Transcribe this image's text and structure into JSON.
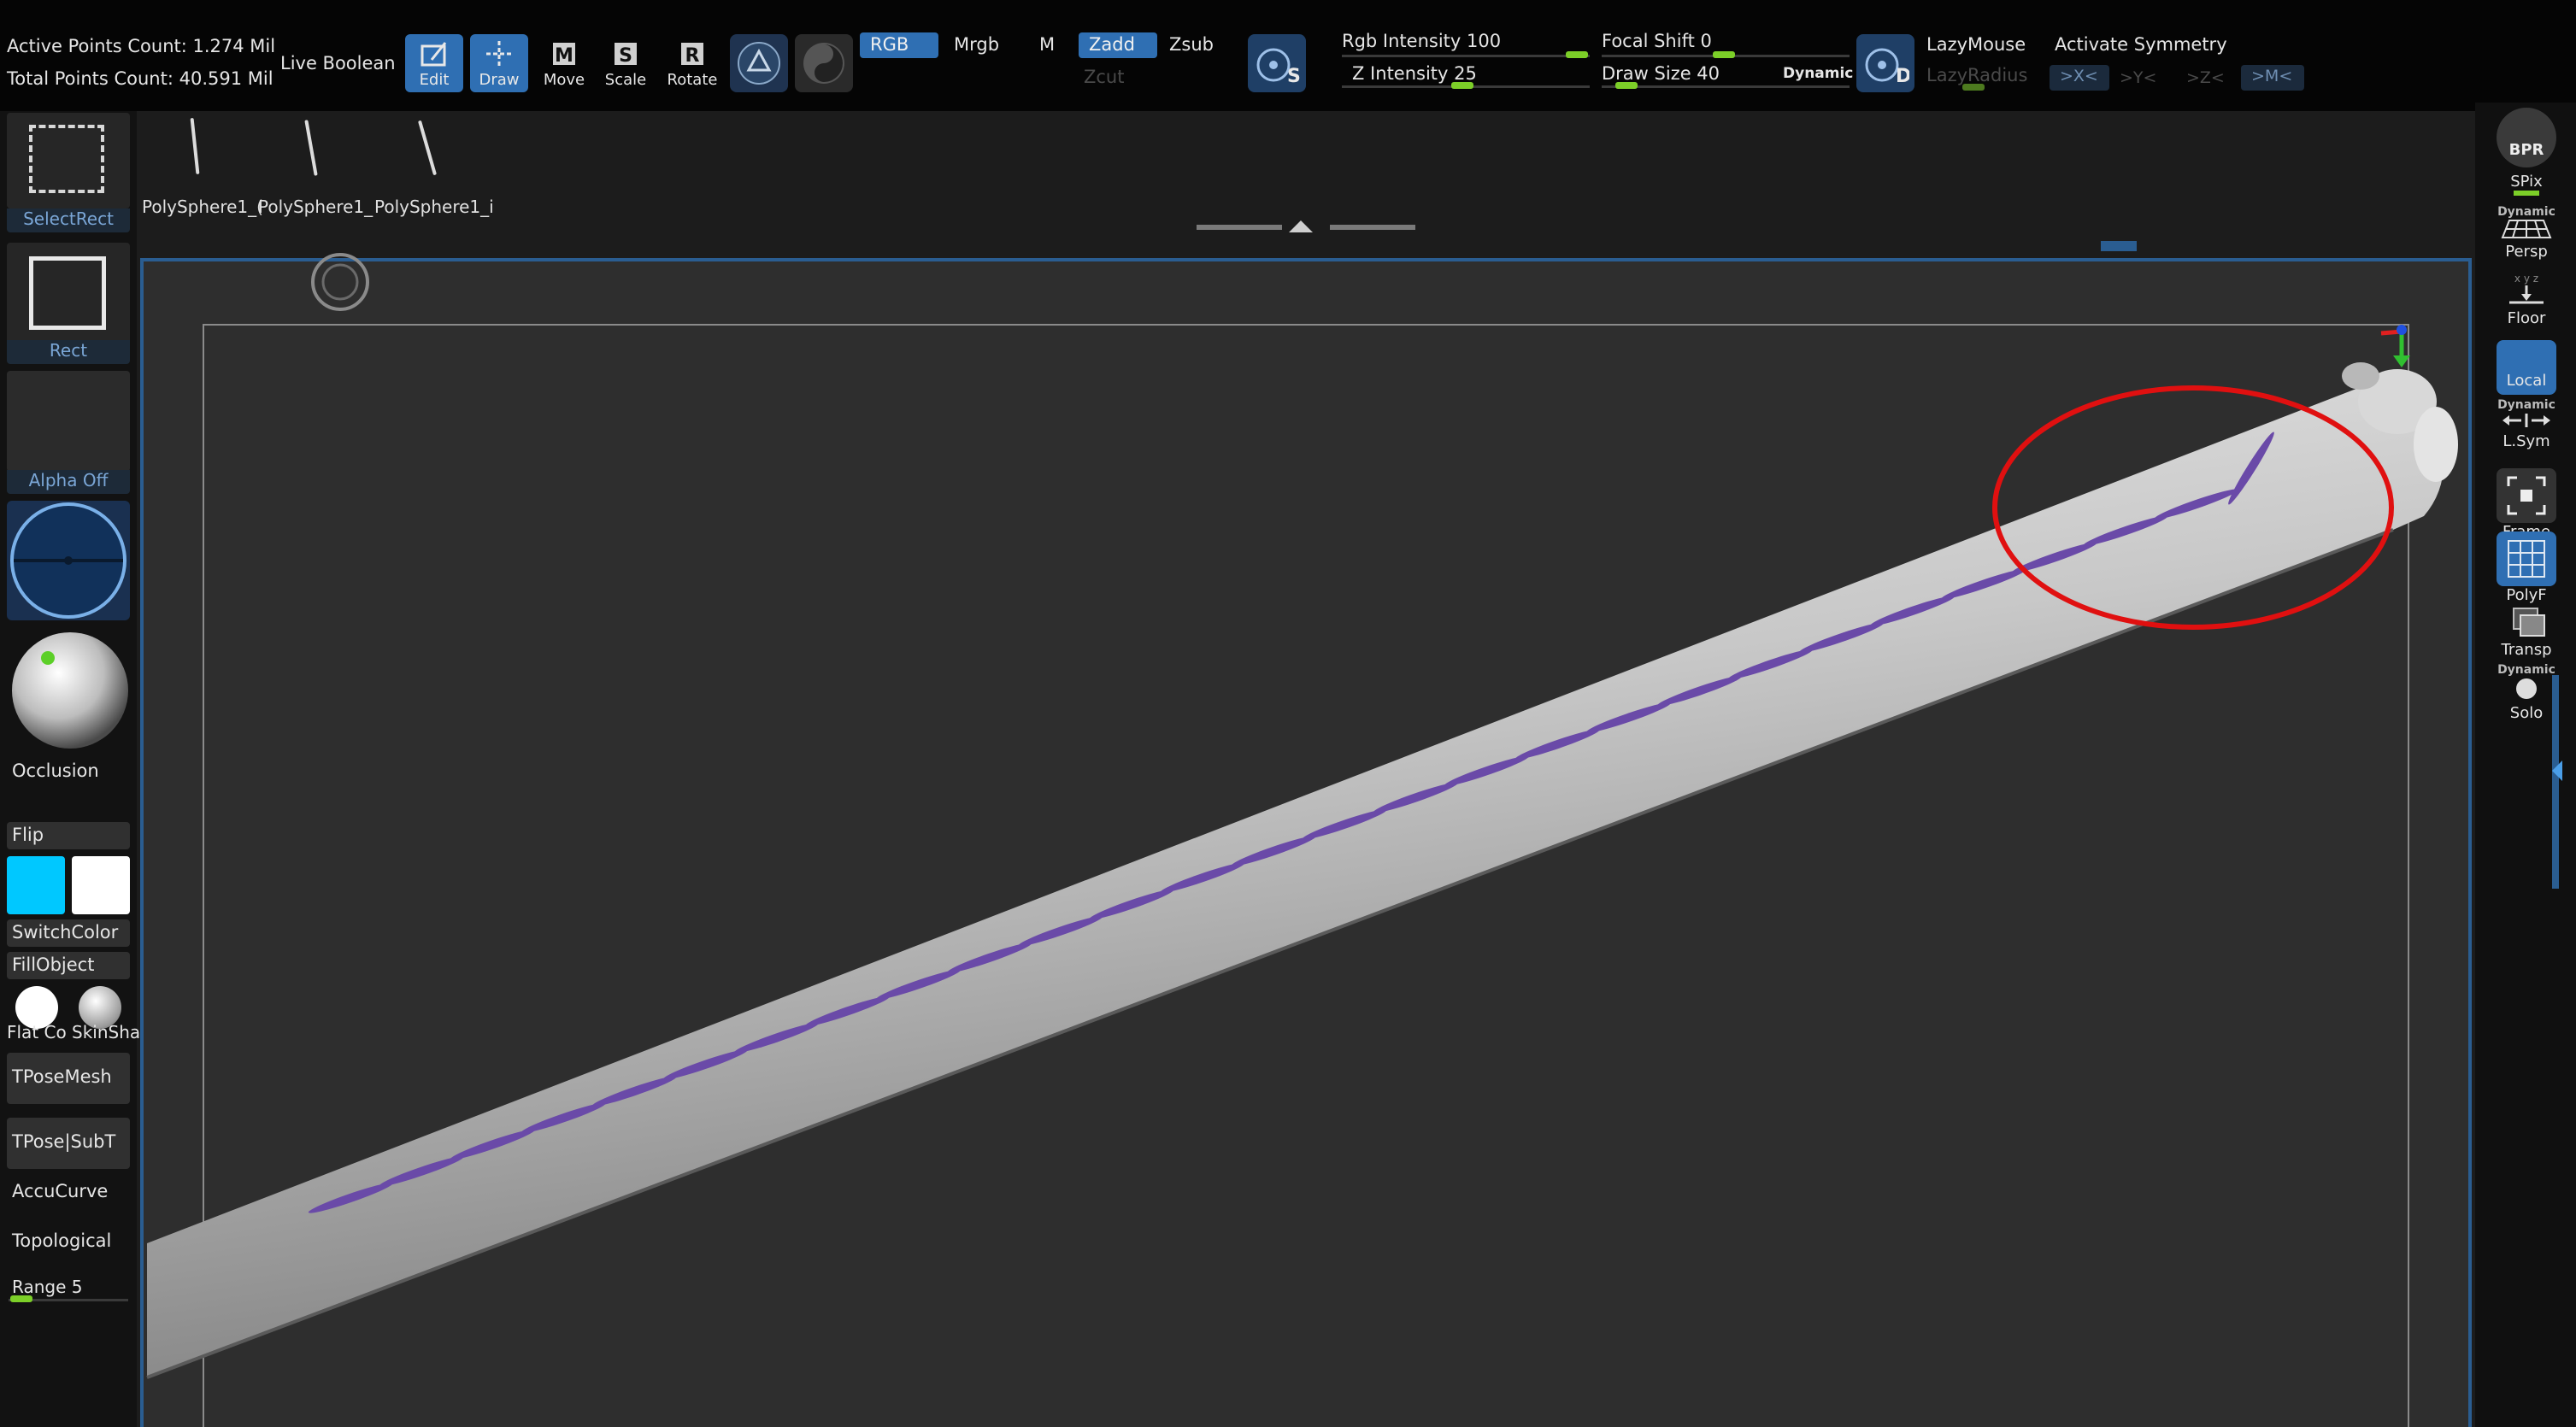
{
  "stats": {
    "active_points": "Active Points Count: 1.274 Mil",
    "total_points": "Total Points Count: 40.591 Mil"
  },
  "toolbar": {
    "live_boolean": "Live Boolean",
    "edit": "Edit",
    "draw": "Draw",
    "move": "Move",
    "scale": "Scale",
    "rotate": "Rotate",
    "rgb": "RGB",
    "mrgb": "Mrgb",
    "m": "M",
    "zadd": "Zadd",
    "zsub": "Zsub",
    "zcut": "Zcut",
    "rgb_intensity": "Rgb Intensity 100",
    "z_intensity": "Z Intensity 25",
    "focal_shift": "Focal Shift 0",
    "draw_size": "Draw Size 40",
    "dynamic": "Dynamic",
    "lazymouse": "LazyMouse",
    "lazyradius": "LazyRadius",
    "activate_symmetry": "Activate Symmetry",
    "sym_x": ">X<",
    "sym_y": ">Y<",
    "sym_z": ">Z<",
    "sym_m": ">M<",
    "rgb_intensity_value": 100,
    "z_intensity_value": 25,
    "focal_shift_value": 0,
    "draw_size_value": 40
  },
  "subtools": [
    {
      "label": "PolySphere1_("
    },
    {
      "label": "PolySphere1_"
    },
    {
      "label": "PolySphere1_i"
    }
  ],
  "left_shelf": {
    "select_rect": "SelectRect",
    "rect": "Rect",
    "alpha_off": "Alpha Off",
    "occlusion": "Occlusion",
    "flip": "Flip",
    "switch_color": "SwitchColor",
    "fill_object": "FillObject",
    "flat_color": "Flat Co",
    "skin_shade": "SkinSha",
    "tpose_mesh": "TPoseMesh",
    "tpose_subt": "TPose|SubT",
    "accucurve": "AccuCurve",
    "topological": "Topological",
    "range": "Range 5",
    "main_color": "#00c8ff",
    "secondary_color": "#ffffff"
  },
  "right_shelf": {
    "bpr": "BPR",
    "spix": "SPix",
    "dynamic": "Dynamic",
    "persp": "Persp",
    "floor": "Floor",
    "local": "Local",
    "dynamic2": "Dynamic",
    "lsym": "L.Sym",
    "frame": "Frame",
    "polyf": "PolyF",
    "transp": "Transp",
    "dynamic3": "Dynamic",
    "solo": "Solo"
  },
  "colors": {
    "accent": "#2f6fb3",
    "slider": "#7ccf28",
    "stroke": "#6a4aa8",
    "highlight": "#e01010"
  }
}
